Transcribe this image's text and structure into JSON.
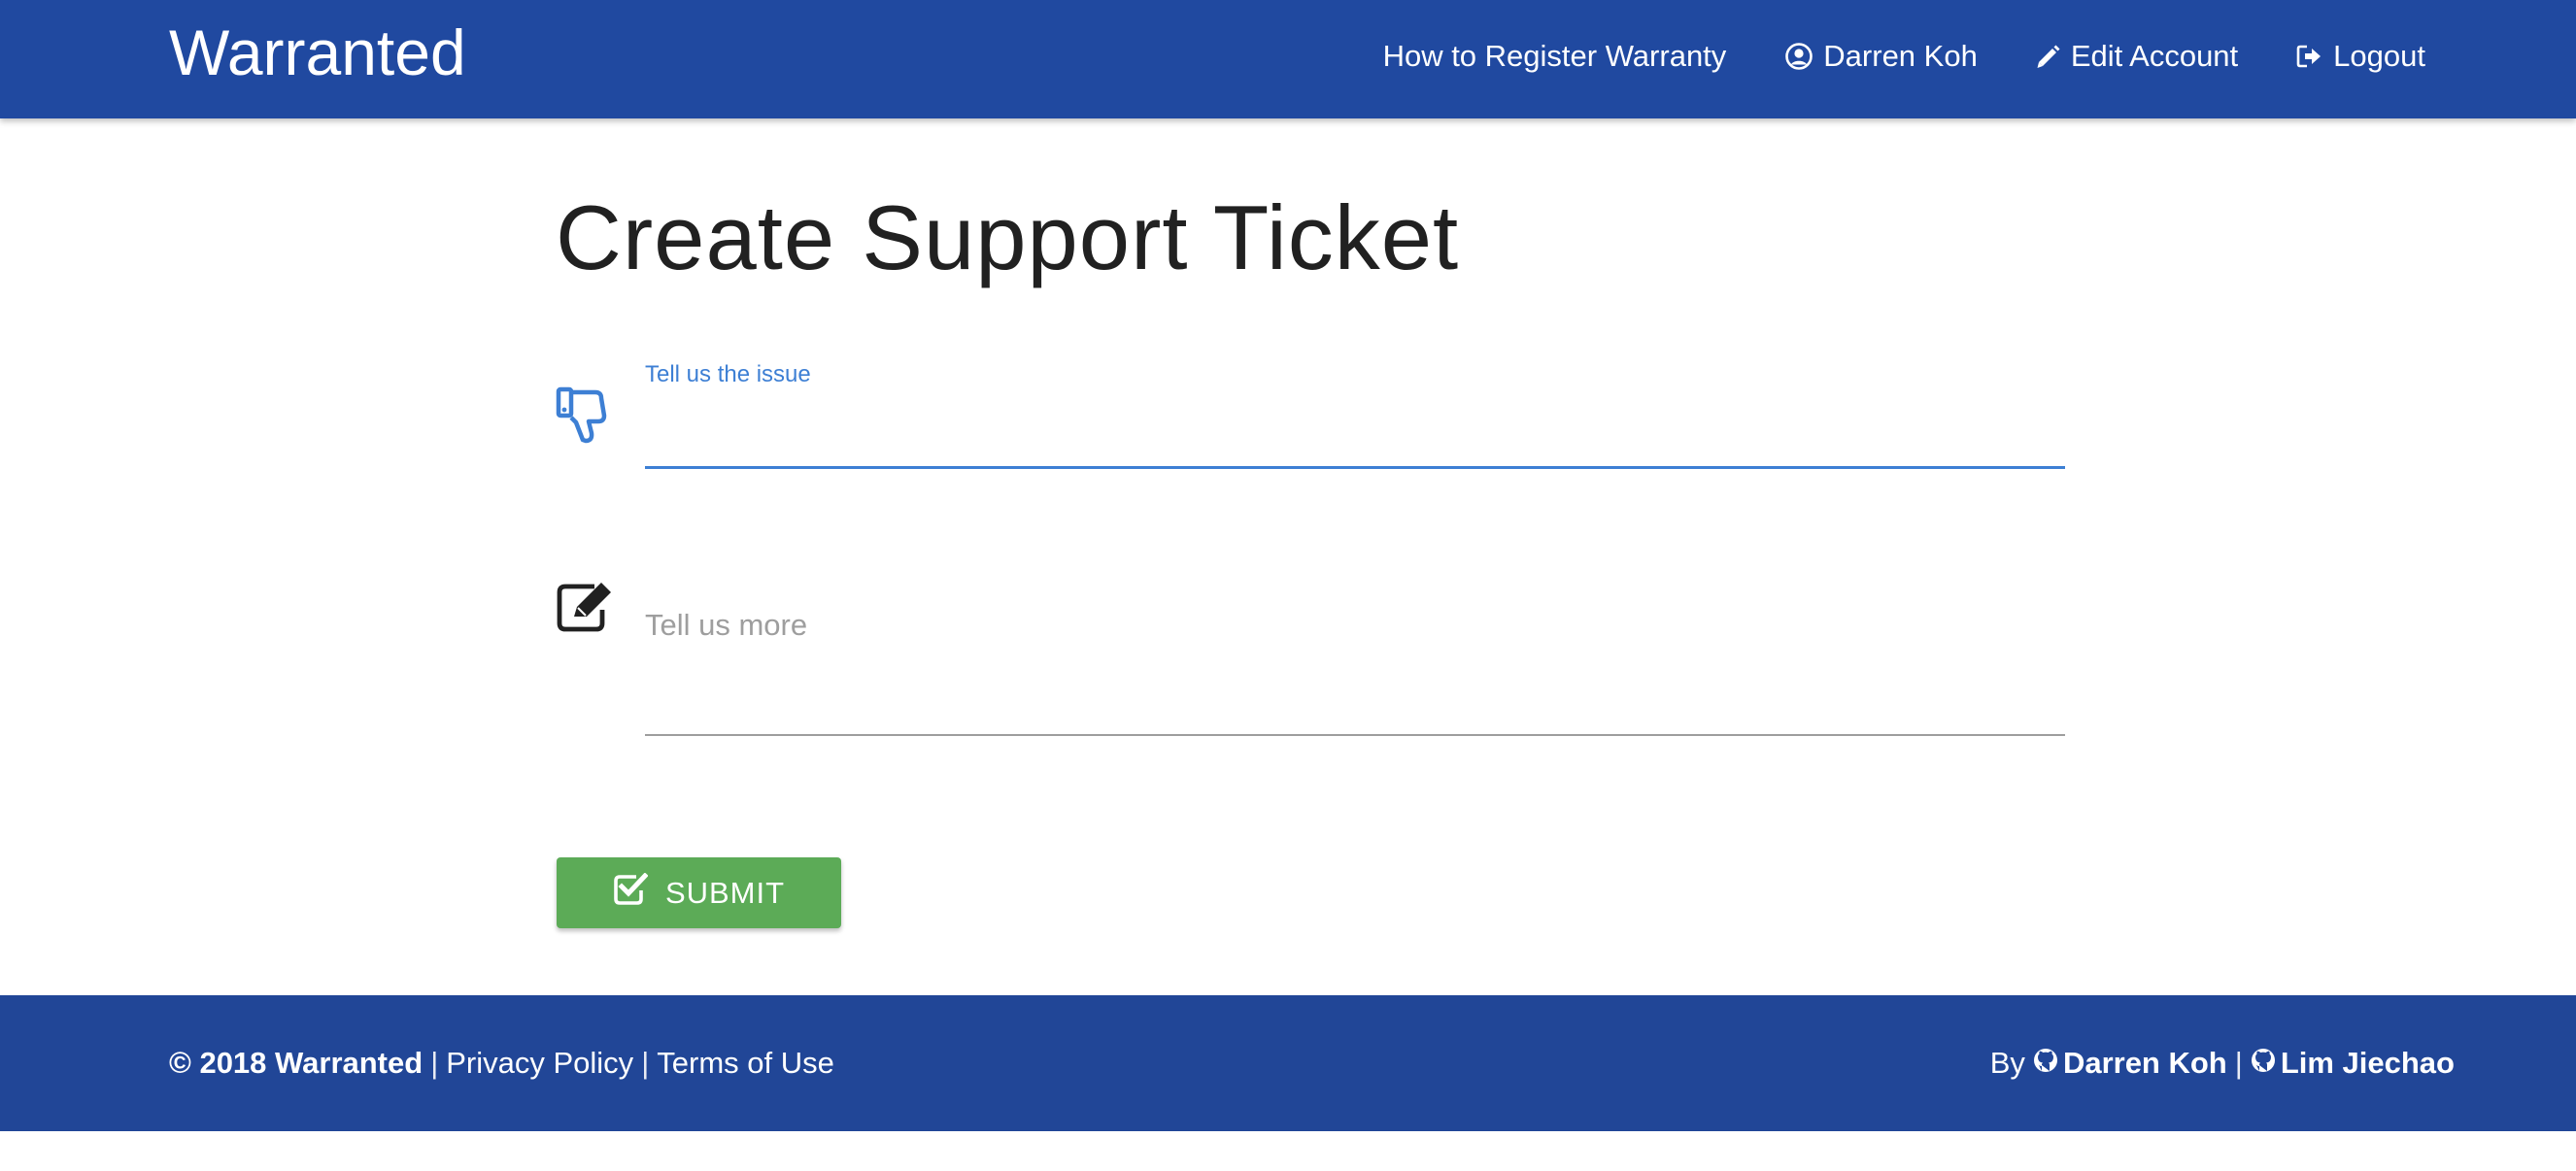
{
  "header": {
    "brand": "Warranted",
    "nav": {
      "register_help": "How to Register Warranty",
      "user_name": "Darren Koh",
      "edit_account": "Edit Account",
      "logout": "Logout"
    }
  },
  "main": {
    "title": "Create Support Ticket",
    "issue_field": {
      "label": "Tell us the issue",
      "value": "",
      "icon": "thumbs-down-icon"
    },
    "more_field": {
      "placeholder": "Tell us more",
      "value": "",
      "icon": "edit-icon"
    },
    "submit": {
      "label": "SUBMIT",
      "icon": "check-square-icon"
    }
  },
  "footer": {
    "copyright": "© 2018 Warranted",
    "separator": "|",
    "privacy": "Privacy Policy",
    "terms": "Terms of Use",
    "by": "By",
    "author1": "Darren Koh",
    "author2": "Lim Jiechao"
  },
  "colors": {
    "header_bg": "#2049a0",
    "footer_bg": "#214697",
    "accent_blue": "#3d7fd4",
    "submit_green": "#5cab57"
  }
}
